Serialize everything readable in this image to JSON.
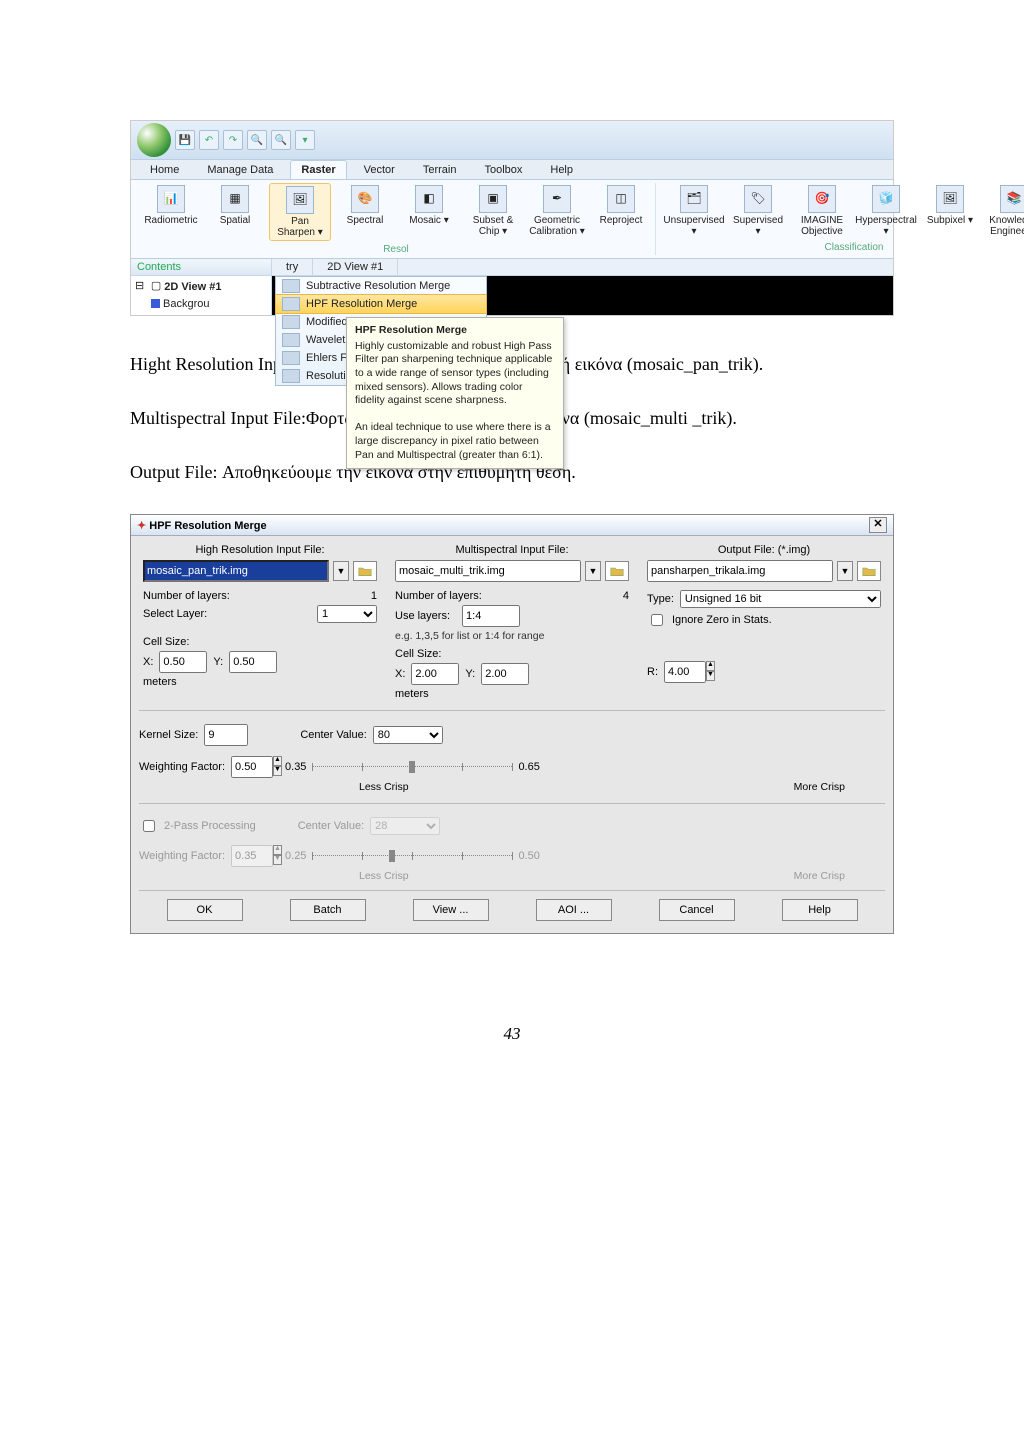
{
  "erdas": {
    "tabs": [
      "Home",
      "Manage Data",
      "Raster",
      "Vector",
      "Terrain",
      "Toolbox",
      "Help"
    ],
    "active_tab": 2,
    "ribbon_left": [
      "Radiometric",
      "Spatial",
      "Pan Sharpen ▾",
      "Spectral",
      "Mosaic ▾",
      "Subset & Chip ▾",
      "Geometric Calibration ▾",
      "Reproject"
    ],
    "ribbon_left_active": 2,
    "ribbon_right": [
      "Unsupervised ▾",
      "Supervised ▾",
      "IMAGINE Objective",
      "Hyperspectral ▾",
      "Subpixel ▾",
      "Knowledge Engineer ▾"
    ],
    "group_left_cap": "Resol",
    "group_right_cap": "Classification",
    "contents_label": "Contents",
    "tree_root": "2D View #1",
    "tree_child": "Backgrou",
    "view_tabs_first": "try",
    "view_tab_main": "2D View #1",
    "menu_items": [
      "Subtractive Resolution Merge",
      "HPF Resolution Merge",
      "Modified IHS Resolution Merge",
      "Wavelet R",
      "Ehlers Fu",
      "Resolutio"
    ],
    "menu_highlight": 1,
    "tooltip_title": "HPF Resolution Merge",
    "tooltip_body1": "Highly customizable and robust High Pass Filter pan sharpening technique applicable to a wide range of sensor types (including mixed sensors). Allows trading color fidelity against scene sharpness.",
    "tooltip_body2": "An ideal technique to use where there is a large discrepancy in pixel ratio between Pan and Multispectral (greater than 6:1)."
  },
  "body": {
    "p1": "Hight Resolution Input File: Φορτώνουμε την παγχρωματική εικόνα (mosaic_pan_trik).",
    "p2": "Multispectral Input File:Φορτώνουμε την multispectral εικόνα  (mosaic_multi _trik).",
    "p3": "Output File: Αποθηκεύουμε την εικόνα στην επιθυμητή θέση."
  },
  "hpf": {
    "title": "HPF Resolution Merge",
    "close": "✕",
    "col_high": "High Resolution Input File:",
    "col_multi": "Multispectral Input File:",
    "col_out": "Output File: (*.img)",
    "file_high": "mosaic_pan_trik.img",
    "file_multi": "mosaic_multi_trik.img",
    "file_out": "pansharpen_trikala.img",
    "num_layers_lbl": "Number of layers:",
    "num_layers_high": "1",
    "num_layers_multi": "4",
    "select_layer_lbl": "Select Layer:",
    "select_layer_val": "1",
    "use_layers_lbl": "Use layers:",
    "use_layers_val": "1:4",
    "use_layers_hint": "e.g. 1,3,5 for list or 1:4 for range",
    "type_lbl": "Type:",
    "type_val": "Unsigned 16 bit",
    "ignore_zero": "Ignore Zero in Stats.",
    "cell_size": "Cell Size:",
    "xlbl": "X:",
    "ylbl": "Y:",
    "cs_high_x": "0.50",
    "cs_high_y": "0.50",
    "cs_multi_x": "2.00",
    "cs_multi_y": "2.00",
    "meters": "meters",
    "r_lbl": "R:",
    "r_val": "4.00",
    "kernel_lbl": "Kernel Size:",
    "kernel_val": "9",
    "center_lbl": "Center Value:",
    "center_val1": "80",
    "wf_lbl": "Weighting Factor:",
    "wf_val1": "0.50",
    "wf_min1": "0.35",
    "wf_max1": "0.65",
    "less": "Less Crisp",
    "more": "More Crisp",
    "pass2": "2-Pass Processing",
    "center_val2": "28",
    "wf_val2": "0.35",
    "wf_min2": "0.25",
    "wf_max2": "0.50",
    "btn_ok": "OK",
    "btn_batch": "Batch",
    "btn_view": "View ...",
    "btn_aoi": "AOI ...",
    "btn_cancel": "Cancel",
    "btn_help": "Help"
  },
  "pagenum": "43"
}
